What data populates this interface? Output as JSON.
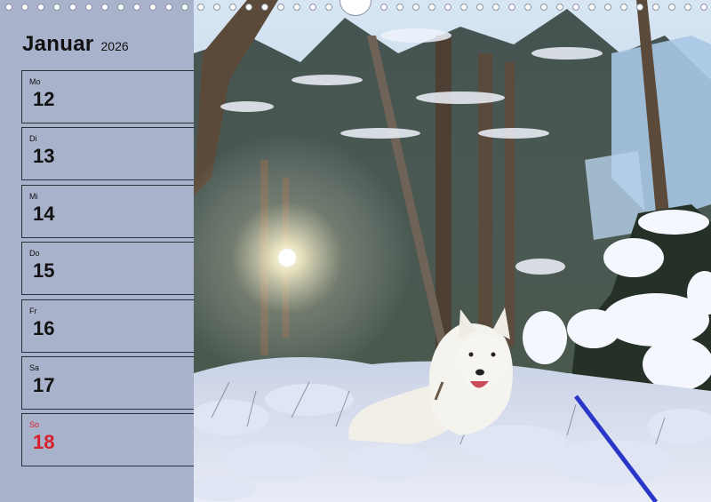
{
  "calendar": {
    "month": "Januar",
    "year": "2026",
    "days": [
      {
        "weekday": "Mo",
        "day": "12"
      },
      {
        "weekday": "Di",
        "day": "13"
      },
      {
        "weekday": "Mi",
        "day": "14"
      },
      {
        "weekday": "Do",
        "day": "15"
      },
      {
        "weekday": "Fr",
        "day": "16"
      },
      {
        "weekday": "Sa",
        "day": "17"
      },
      {
        "weekday": "So",
        "day": "18"
      }
    ]
  },
  "colors": {
    "panel": "#a9b2cb",
    "text": "#111111",
    "sunday": "#d81e2a",
    "leash": "#2a36c8"
  },
  "photo": {
    "icon": "white-shepherd-dog-in-snowy-forest-photo"
  }
}
